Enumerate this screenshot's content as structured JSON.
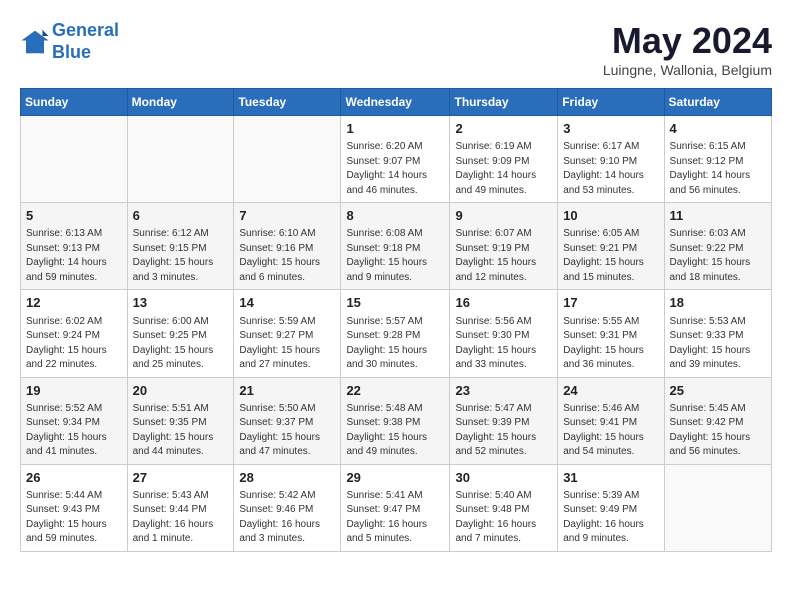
{
  "header": {
    "logo_line1": "General",
    "logo_line2": "Blue",
    "month": "May 2024",
    "location": "Luingne, Wallonia, Belgium"
  },
  "weekdays": [
    "Sunday",
    "Monday",
    "Tuesday",
    "Wednesday",
    "Thursday",
    "Friday",
    "Saturday"
  ],
  "weeks": [
    [
      {
        "day": "",
        "info": ""
      },
      {
        "day": "",
        "info": ""
      },
      {
        "day": "",
        "info": ""
      },
      {
        "day": "1",
        "info": "Sunrise: 6:20 AM\nSunset: 9:07 PM\nDaylight: 14 hours\nand 46 minutes."
      },
      {
        "day": "2",
        "info": "Sunrise: 6:19 AM\nSunset: 9:09 PM\nDaylight: 14 hours\nand 49 minutes."
      },
      {
        "day": "3",
        "info": "Sunrise: 6:17 AM\nSunset: 9:10 PM\nDaylight: 14 hours\nand 53 minutes."
      },
      {
        "day": "4",
        "info": "Sunrise: 6:15 AM\nSunset: 9:12 PM\nDaylight: 14 hours\nand 56 minutes."
      }
    ],
    [
      {
        "day": "5",
        "info": "Sunrise: 6:13 AM\nSunset: 9:13 PM\nDaylight: 14 hours\nand 59 minutes."
      },
      {
        "day": "6",
        "info": "Sunrise: 6:12 AM\nSunset: 9:15 PM\nDaylight: 15 hours\nand 3 minutes."
      },
      {
        "day": "7",
        "info": "Sunrise: 6:10 AM\nSunset: 9:16 PM\nDaylight: 15 hours\nand 6 minutes."
      },
      {
        "day": "8",
        "info": "Sunrise: 6:08 AM\nSunset: 9:18 PM\nDaylight: 15 hours\nand 9 minutes."
      },
      {
        "day": "9",
        "info": "Sunrise: 6:07 AM\nSunset: 9:19 PM\nDaylight: 15 hours\nand 12 minutes."
      },
      {
        "day": "10",
        "info": "Sunrise: 6:05 AM\nSunset: 9:21 PM\nDaylight: 15 hours\nand 15 minutes."
      },
      {
        "day": "11",
        "info": "Sunrise: 6:03 AM\nSunset: 9:22 PM\nDaylight: 15 hours\nand 18 minutes."
      }
    ],
    [
      {
        "day": "12",
        "info": "Sunrise: 6:02 AM\nSunset: 9:24 PM\nDaylight: 15 hours\nand 22 minutes."
      },
      {
        "day": "13",
        "info": "Sunrise: 6:00 AM\nSunset: 9:25 PM\nDaylight: 15 hours\nand 25 minutes."
      },
      {
        "day": "14",
        "info": "Sunrise: 5:59 AM\nSunset: 9:27 PM\nDaylight: 15 hours\nand 27 minutes."
      },
      {
        "day": "15",
        "info": "Sunrise: 5:57 AM\nSunset: 9:28 PM\nDaylight: 15 hours\nand 30 minutes."
      },
      {
        "day": "16",
        "info": "Sunrise: 5:56 AM\nSunset: 9:30 PM\nDaylight: 15 hours\nand 33 minutes."
      },
      {
        "day": "17",
        "info": "Sunrise: 5:55 AM\nSunset: 9:31 PM\nDaylight: 15 hours\nand 36 minutes."
      },
      {
        "day": "18",
        "info": "Sunrise: 5:53 AM\nSunset: 9:33 PM\nDaylight: 15 hours\nand 39 minutes."
      }
    ],
    [
      {
        "day": "19",
        "info": "Sunrise: 5:52 AM\nSunset: 9:34 PM\nDaylight: 15 hours\nand 41 minutes."
      },
      {
        "day": "20",
        "info": "Sunrise: 5:51 AM\nSunset: 9:35 PM\nDaylight: 15 hours\nand 44 minutes."
      },
      {
        "day": "21",
        "info": "Sunrise: 5:50 AM\nSunset: 9:37 PM\nDaylight: 15 hours\nand 47 minutes."
      },
      {
        "day": "22",
        "info": "Sunrise: 5:48 AM\nSunset: 9:38 PM\nDaylight: 15 hours\nand 49 minutes."
      },
      {
        "day": "23",
        "info": "Sunrise: 5:47 AM\nSunset: 9:39 PM\nDaylight: 15 hours\nand 52 minutes."
      },
      {
        "day": "24",
        "info": "Sunrise: 5:46 AM\nSunset: 9:41 PM\nDaylight: 15 hours\nand 54 minutes."
      },
      {
        "day": "25",
        "info": "Sunrise: 5:45 AM\nSunset: 9:42 PM\nDaylight: 15 hours\nand 56 minutes."
      }
    ],
    [
      {
        "day": "26",
        "info": "Sunrise: 5:44 AM\nSunset: 9:43 PM\nDaylight: 15 hours\nand 59 minutes."
      },
      {
        "day": "27",
        "info": "Sunrise: 5:43 AM\nSunset: 9:44 PM\nDaylight: 16 hours\nand 1 minute."
      },
      {
        "day": "28",
        "info": "Sunrise: 5:42 AM\nSunset: 9:46 PM\nDaylight: 16 hours\nand 3 minutes."
      },
      {
        "day": "29",
        "info": "Sunrise: 5:41 AM\nSunset: 9:47 PM\nDaylight: 16 hours\nand 5 minutes."
      },
      {
        "day": "30",
        "info": "Sunrise: 5:40 AM\nSunset: 9:48 PM\nDaylight: 16 hours\nand 7 minutes."
      },
      {
        "day": "31",
        "info": "Sunrise: 5:39 AM\nSunset: 9:49 PM\nDaylight: 16 hours\nand 9 minutes."
      },
      {
        "day": "",
        "info": ""
      }
    ]
  ]
}
